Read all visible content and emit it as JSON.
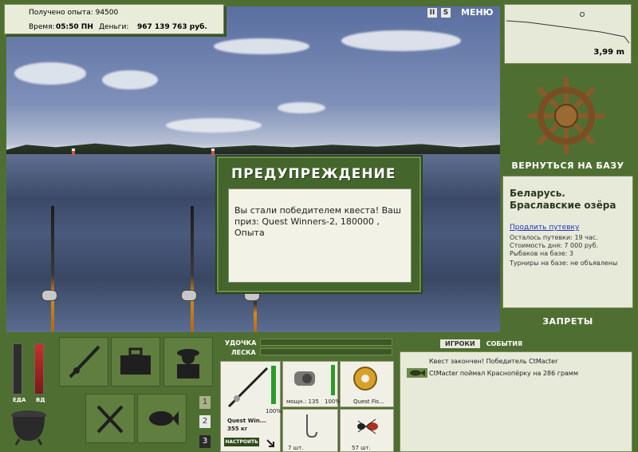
{
  "hud": {
    "xp_label": "Получено опыта: 94500",
    "time_label": "Время:",
    "time_value": "05:50 ПН",
    "money_label": "Деньги:",
    "money_value": "967 139 763 руб."
  },
  "top_controls": {
    "pause": "II",
    "sound": "S",
    "menu": "МЕНЮ"
  },
  "depth": {
    "value": "3,99 m"
  },
  "dialog": {
    "title": "ПРЕДУПРЕЖДЕНИЕ",
    "message": "Вы стали победителем квеста! Ваш приз: Quest Winners-2, 180000 , Опыта"
  },
  "right": {
    "return_button": "ВЕРНУТЬСЯ НА БАЗУ",
    "location": "Беларусь. Браславские озёра",
    "extend_link": "Продлить путевку",
    "info": [
      "Осталось путевки: 19 час.",
      "Стоимость дня: 7 000 руб.",
      "Рыбаков на базе: 3",
      "Турниры на базе: не объявлены"
    ],
    "bans_button": "ЗАПРЕТЫ"
  },
  "status_bars": {
    "food_label": "ЕДА",
    "vodka_label": "ВД",
    "food_level": 0.0,
    "vodka_level": 0.95
  },
  "page_buttons": [
    "1",
    "2",
    "3"
  ],
  "tackle": {
    "rod_label": "УДОЧКА",
    "line_label": "ЛЕСКА",
    "rod_name": "Quest Win...",
    "rod_weight": "355 кг",
    "rod_pct": "100%",
    "reel_label": "мощн.: 135",
    "reel_pct": "100%",
    "line_name": "Quest Fis...",
    "hook_count": "7 шт.",
    "bait_count": "57 шт.",
    "setup_button": "НАСТРОИТЬ"
  },
  "events": {
    "tab_players": "ИГРОКИ",
    "tab_events": "СОБЫТИЯ",
    "messages": [
      "Квест закончен! Победитель CtMacter",
      "CtMacter поймал Краснопёрку на 286 грамм"
    ]
  }
}
